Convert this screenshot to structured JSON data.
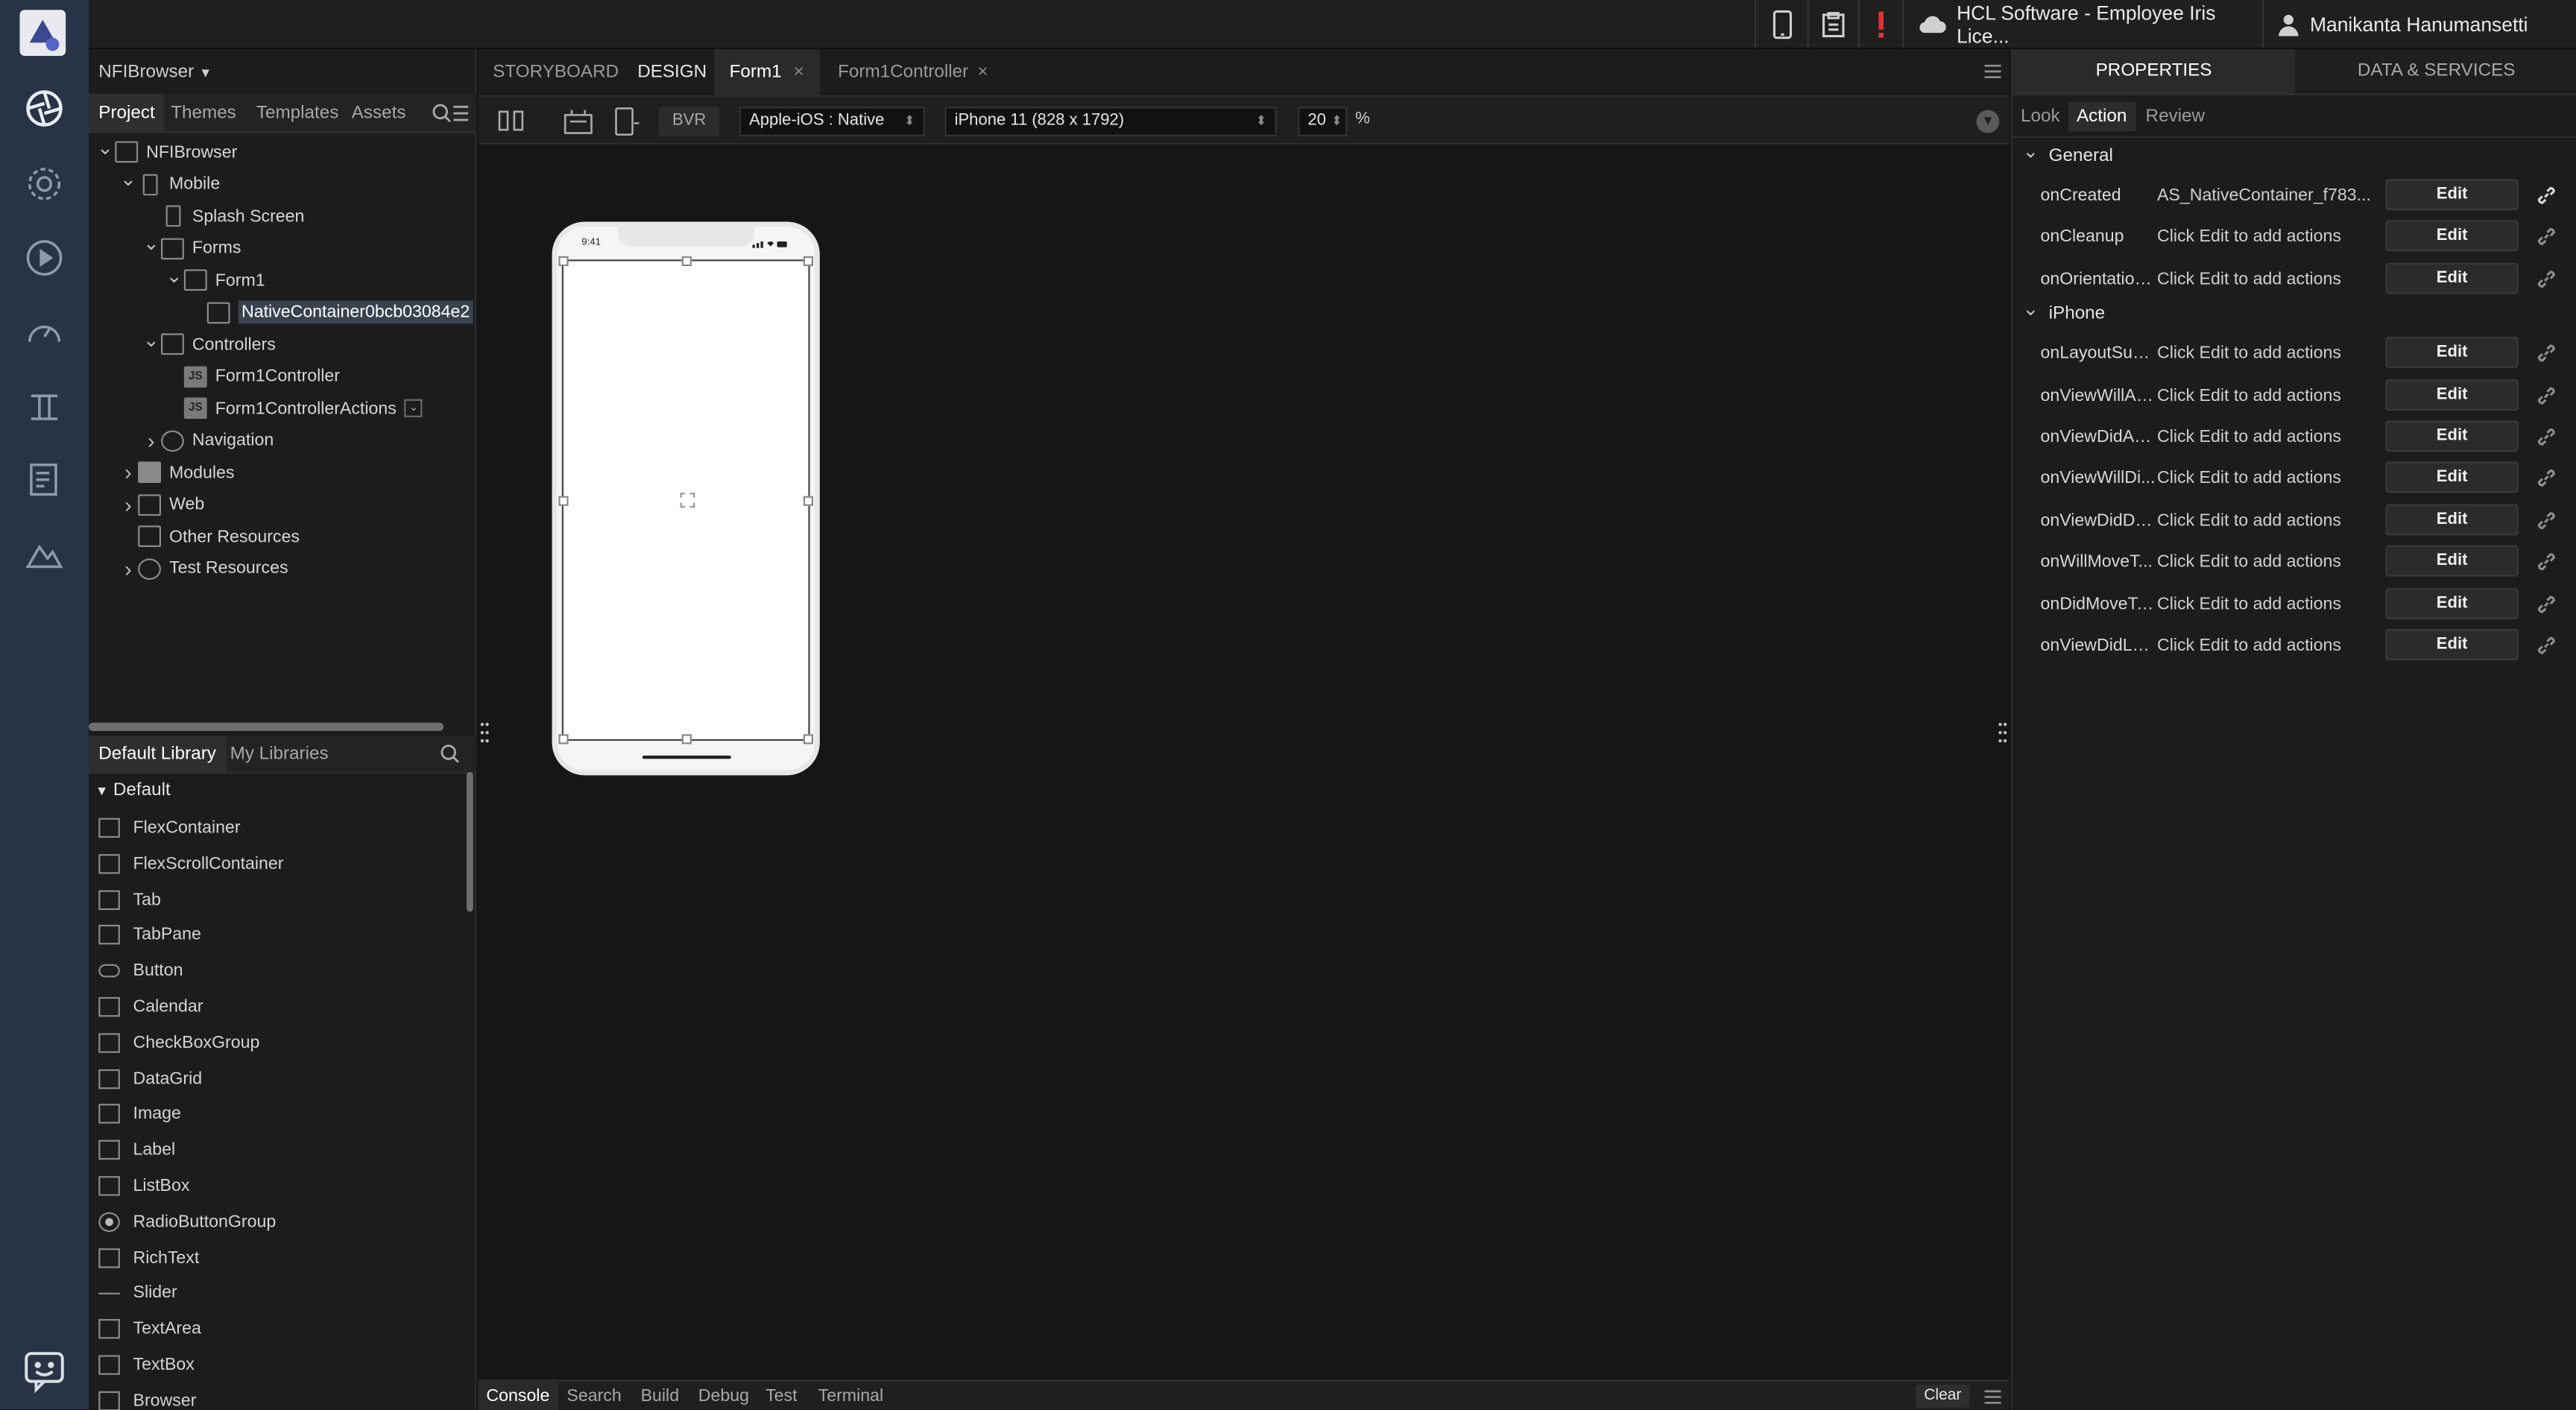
{
  "topbar": {
    "account": "HCL Software - Employee Iris Lice...",
    "user": "Manikanta Hanumansetti"
  },
  "left_panel": {
    "project_name": "NFIBrowser",
    "tabs": [
      "Project",
      "Themes",
      "Templates",
      "Assets"
    ],
    "tree": [
      {
        "label": "NFIBrowser",
        "indent": 0,
        "chevron": "down",
        "icon": "grid"
      },
      {
        "label": "Mobile",
        "indent": 1,
        "chevron": "down",
        "icon": "phone"
      },
      {
        "label": "Splash Screen",
        "indent": 2,
        "chevron": "",
        "icon": "phone"
      },
      {
        "label": "Forms",
        "indent": 2,
        "chevron": "down",
        "icon": "form"
      },
      {
        "label": "Form1",
        "indent": 3,
        "chevron": "down",
        "icon": "form"
      },
      {
        "label": "NativeContainer0bcb03084e2",
        "indent": 4,
        "chevron": "",
        "icon": "box",
        "selected": true
      },
      {
        "label": "Controllers",
        "indent": 2,
        "chevron": "down",
        "icon": "folder"
      },
      {
        "label": "Form1Controller",
        "indent": 3,
        "chevron": "",
        "icon": "js"
      },
      {
        "label": "Form1ControllerActions",
        "indent": 3,
        "chevron": "",
        "icon": "js"
      },
      {
        "label": "Navigation",
        "indent": 2,
        "chevron": "right",
        "icon": "compass"
      },
      {
        "label": "Modules",
        "indent": 1,
        "chevron": "right",
        "icon": "square"
      },
      {
        "label": "Web",
        "indent": 1,
        "chevron": "right",
        "icon": "grid"
      },
      {
        "label": "Other Resources",
        "indent": 1,
        "chevron": "",
        "icon": "folder"
      },
      {
        "label": "Test Resources",
        "indent": 1,
        "chevron": "right",
        "icon": "gauge"
      }
    ],
    "library_tabs": [
      "Default Library",
      "My Libraries"
    ],
    "library_section": "Default",
    "library_items": [
      "FlexContainer",
      "FlexScrollContainer",
      "Tab",
      "TabPane",
      "Button",
      "Calendar",
      "CheckBoxGroup",
      "DataGrid",
      "Image",
      "Label",
      "ListBox",
      "RadioButtonGroup",
      "RichText",
      "Slider",
      "TextArea",
      "TextBox",
      "Browser"
    ]
  },
  "center": {
    "tabs": [
      "STORYBOARD",
      "DESIGN",
      "Form1",
      "Form1Controller"
    ],
    "toolbar": {
      "bvr": "BVR",
      "platform": "Apple-iOS : Native",
      "device": "iPhone 11 (828 x 1792)",
      "zoom": "20",
      "zoom_unit": "%"
    },
    "phone_time": "9:41",
    "bottom_tabs": [
      "Console",
      "Search",
      "Build",
      "Debug",
      "Test",
      "Terminal"
    ],
    "clear": "Clear"
  },
  "right_panel": {
    "tabs": [
      "PROPERTIES",
      "DATA & SERVICES"
    ],
    "subtabs": [
      "Look",
      "Action",
      "Review"
    ],
    "edit_label": "Edit",
    "sections": [
      {
        "title": "General",
        "events": [
          {
            "name": "onCreated",
            "value": "AS_NativeContainer_f783..."
          },
          {
            "name": "onCleanup",
            "value": "Click Edit to add actions"
          },
          {
            "name": "onOrientation...",
            "value": "Click Edit to add actions"
          }
        ]
      },
      {
        "title": "iPhone",
        "events": [
          {
            "name": "onLayoutSub...",
            "value": "Click Edit to add actions"
          },
          {
            "name": "onViewWillAp...",
            "value": "Click Edit to add actions"
          },
          {
            "name": "onViewDidAp...",
            "value": "Click Edit to add actions"
          },
          {
            "name": "onViewWillDi...",
            "value": "Click Edit to add actions"
          },
          {
            "name": "onViewDidDis...",
            "value": "Click Edit to add actions"
          },
          {
            "name": "onWillMoveT...",
            "value": "Click Edit to add actions"
          },
          {
            "name": "onDidMoveTo...",
            "value": "Click Edit to add actions"
          },
          {
            "name": "onViewDidLo...",
            "value": "Click Edit to add actions"
          }
        ]
      }
    ]
  },
  "colors": {
    "rail_bg": "#283346",
    "panel_bg": "#1c1c1c",
    "canvas_bg": "#161616",
    "error_red": "#e03131"
  }
}
